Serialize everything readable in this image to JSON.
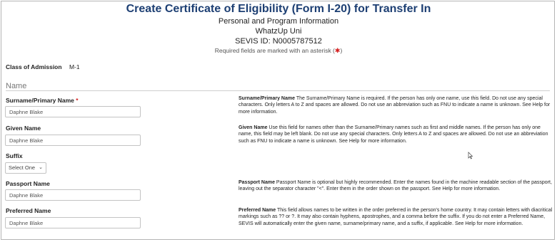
{
  "header": {
    "title": "Create Certificate of Eligibility (Form I-20) for Transfer In",
    "subtitle": "Personal and Program Information",
    "school": "WhatzUp Uni",
    "sevis_id": "SEVIS ID: N0005787512",
    "required_note_before": "Required fields are marked with an asterisk (",
    "required_note_after": ")",
    "required_symbol": "✱"
  },
  "class_of_admission": {
    "label": "Class of Admission",
    "value": "M-1"
  },
  "name_section": {
    "title": "Name",
    "fields": {
      "surname": {
        "label": "Surname/Primary Name",
        "required": "*",
        "value": "Daphne Blake",
        "help_title": "Surname/Primary Name",
        "help_text": "The Surname/Primary Name is required. If the person has only one name, use this field. Do not use any special characters. Only letters A to Z and spaces are allowed. Do not use an abbreviation such as FNU to indicate a name is unknown. See Help for more information."
      },
      "given": {
        "label": "Given Name",
        "value": "Daphne Blake",
        "help_title": "Given Name",
        "help_text": "Use this field for names other than the Surname/Primary names such as first and middle names. If the person has only one name, this field may be left blank. Do not use any special characters. Only letters A to Z and spaces are allowed. Do not use an abbreviation such as FNU to indicate a name is unknown. See Help for more information."
      },
      "suffix": {
        "label": "Suffix",
        "selected": "Select One"
      },
      "passport": {
        "label": "Passport Name",
        "value": "Daphne Blake",
        "help_title": "Passport Name",
        "help_text": "Passport Name is optional but highly recommended. Enter the names found in the machine readable section of the passport, leaving out the separator character \"<\". Enter them in the order shown on the passport. See Help for more information."
      },
      "preferred": {
        "label": "Preferred Name",
        "value": "Daphne Blake",
        "help_title": "Preferred Name",
        "help_text": "This field allows names to be written in the order preferred in the person's home country. It may contain letters with diacritical markings such as ?? or ?. It may also contain hyphens, apostrophes, and a comma before the suffix. If you do not enter a Preferred Name, SEVIS will automatically enter the given name, surname/primary name, and a suffix, if applicable. See Help for more information."
      }
    }
  }
}
